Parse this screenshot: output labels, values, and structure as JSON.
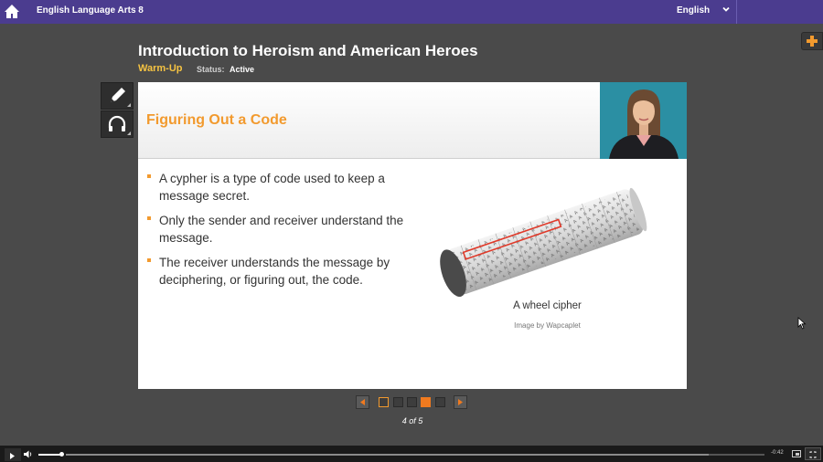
{
  "header": {
    "course_title": "English Language Arts 8",
    "language": "English"
  },
  "lesson": {
    "title": "Introduction to Heroism and American Heroes",
    "activity": "Warm-Up",
    "status_label": "Status:",
    "status_value": "Active"
  },
  "slide": {
    "title": "Figuring Out a Code",
    "bullets": [
      "A cypher is a type of code used to keep a message secret.",
      "Only the sender and receiver understand the message.",
      "The receiver understands the message by deciphering, or figuring out, the code."
    ],
    "image_caption": "A wheel cipher",
    "image_credit": "Image by Wapcaplet"
  },
  "pager": {
    "current_page": 4,
    "total_pages": 5,
    "label": "4 of 5"
  },
  "player": {
    "time_remaining": "-0:42",
    "volume_level": 0.8,
    "progress": 0.0,
    "buffered": 0.92
  },
  "colors": {
    "topbar": "#4b3c8f",
    "accent_orange": "#f29a2e",
    "activity_yellow": "#f5c342",
    "background": "#4a4a4a"
  },
  "icons": {
    "home": "home-icon",
    "language_dropdown": "chevron-down-icon",
    "add": "plus-icon",
    "notes": "pencil-icon",
    "audio": "headphones-icon",
    "prev": "triangle-left-icon",
    "next": "triangle-right-icon"
  }
}
